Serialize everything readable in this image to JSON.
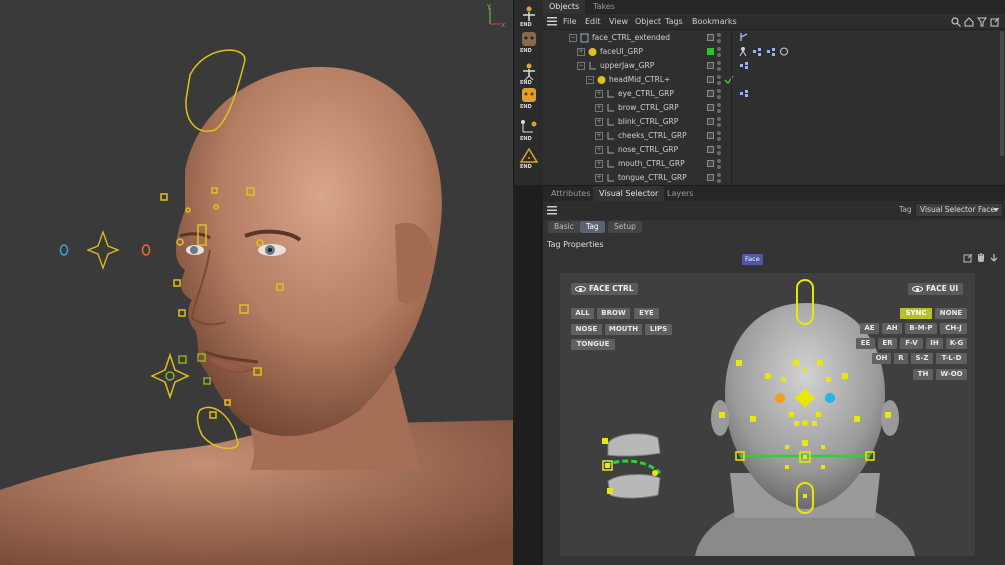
{
  "viewport": {
    "axis": {
      "y_label": "y",
      "x_label": "x"
    }
  },
  "toolbar": {
    "buttons": [
      {
        "name": "joint-tool",
        "label": "END"
      },
      {
        "name": "face-tool",
        "label": "END"
      },
      {
        "name": "character-tool",
        "label": "END"
      },
      {
        "name": "face-tool-2",
        "label": "END"
      },
      {
        "name": "chain-tool",
        "label": "END"
      },
      {
        "name": "warning-tool",
        "label": "END"
      }
    ]
  },
  "object_manager": {
    "tabs": [
      "Objects",
      "Takes"
    ],
    "menu": [
      "File",
      "Edit",
      "View",
      "Object",
      "Tags",
      "Bookmarks"
    ],
    "tree": [
      {
        "name": "face_CTRL_extended",
        "depth": 0,
        "exp": "−"
      },
      {
        "name": "faceUI_GRP",
        "depth": 1,
        "exp": "+"
      },
      {
        "name": "upperJaw_GRP",
        "depth": 1,
        "exp": "−"
      },
      {
        "name": "headMid_CTRL+",
        "depth": 2,
        "exp": "−"
      },
      {
        "name": "eye_CTRL_GRP",
        "depth": 3,
        "exp": "+"
      },
      {
        "name": "brow_CTRL_GRP",
        "depth": 3,
        "exp": "+"
      },
      {
        "name": "blink_CTRL_GRP",
        "depth": 3,
        "exp": "+"
      },
      {
        "name": "cheeks_CTRL_GRP",
        "depth": 3,
        "exp": "+"
      },
      {
        "name": "nose_CTRL_GRP",
        "depth": 3,
        "exp": "+"
      },
      {
        "name": "mouth_CTRL_GRP",
        "depth": 3,
        "exp": "+"
      },
      {
        "name": "tongue_CTRL_GRP",
        "depth": 3,
        "exp": "+"
      }
    ]
  },
  "attributes": {
    "tabs": [
      "Attributes",
      "Visual Selector",
      "Layers"
    ],
    "tag_label": "Tag",
    "tag_dropdown": "Visual Selector Face",
    "subtabs": [
      "Basic",
      "Tag",
      "Setup"
    ],
    "section_title": "Tag Properties",
    "face_chip": "Face"
  },
  "visual_selector": {
    "face_ctrl": "FACE CTRL",
    "face_ui": "FACE UI",
    "left_buttons": [
      [
        "ALL",
        "BROW",
        "EYE"
      ],
      [
        "NOSE",
        "MOUTH",
        "LIPS"
      ],
      [
        "TONGUE"
      ]
    ],
    "right_buttons": [
      [
        "SYNC",
        "NONE"
      ],
      [
        "AE",
        "AH",
        "B-M-P",
        "CH-J"
      ],
      [
        "EE",
        "ER",
        "F-V",
        "IH",
        "K-G"
      ],
      [
        "OH",
        "R",
        "S-Z",
        "T-L-D"
      ],
      [
        "TH",
        "W-OO"
      ]
    ],
    "colors": {
      "accent": "#e8e800",
      "sync": "#b7c22b",
      "eye_left": "#f0a020",
      "eye_right": "#20b8e0",
      "green": "#30d030"
    }
  }
}
